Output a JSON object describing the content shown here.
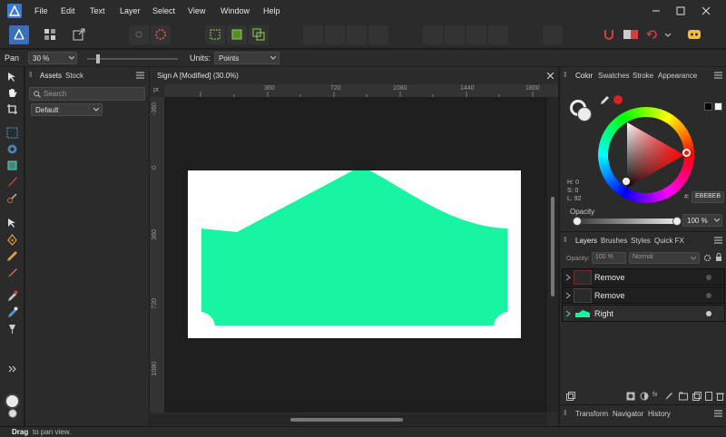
{
  "menu": [
    "File",
    "Edit",
    "Text",
    "Layer",
    "Select",
    "View",
    "Window",
    "Help"
  ],
  "context": {
    "tool_name": "Pan",
    "zoom": "30 %",
    "units_label": "Units:",
    "units_value": "Points"
  },
  "assets_panel": {
    "tabs": [
      "Assets",
      "Stock"
    ],
    "search_placeholder": "Search",
    "category": "Default"
  },
  "document": {
    "title": "Sign A [Modified] (30.0%)",
    "ruler_unit": "pt",
    "h_ticks": [
      "360",
      "720",
      "1080",
      "1440",
      "1800"
    ],
    "v_ticks": [
      "-360",
      "0",
      "360",
      "720",
      "1080"
    ],
    "shape_color": "#18f5a2"
  },
  "color_panel": {
    "tabs": [
      "Color",
      "Swatches",
      "Stroke",
      "Appearance"
    ],
    "hsl": [
      "H: 0",
      "S: 0",
      "L: 92"
    ],
    "hex_label": "#:",
    "hex_value": "EBEBEB",
    "opacity_label": "Opacity",
    "opacity_value": "100 %"
  },
  "layers_panel": {
    "tabs": [
      "Layers",
      "Brushes",
      "Styles",
      "Quick FX"
    ],
    "opacity_label": "Opacity:",
    "opacity_value": "100 %",
    "blend_mode": "Normal",
    "layers": [
      {
        "name": "Remove",
        "thumb": "none"
      },
      {
        "name": "Remove",
        "thumb": "none"
      },
      {
        "name": "Right",
        "thumb": "shape"
      }
    ]
  },
  "bottom_tabs": [
    "Transform",
    "Navigator",
    "History"
  ],
  "status": {
    "bold": "Drag",
    "rest": "to pan view."
  }
}
